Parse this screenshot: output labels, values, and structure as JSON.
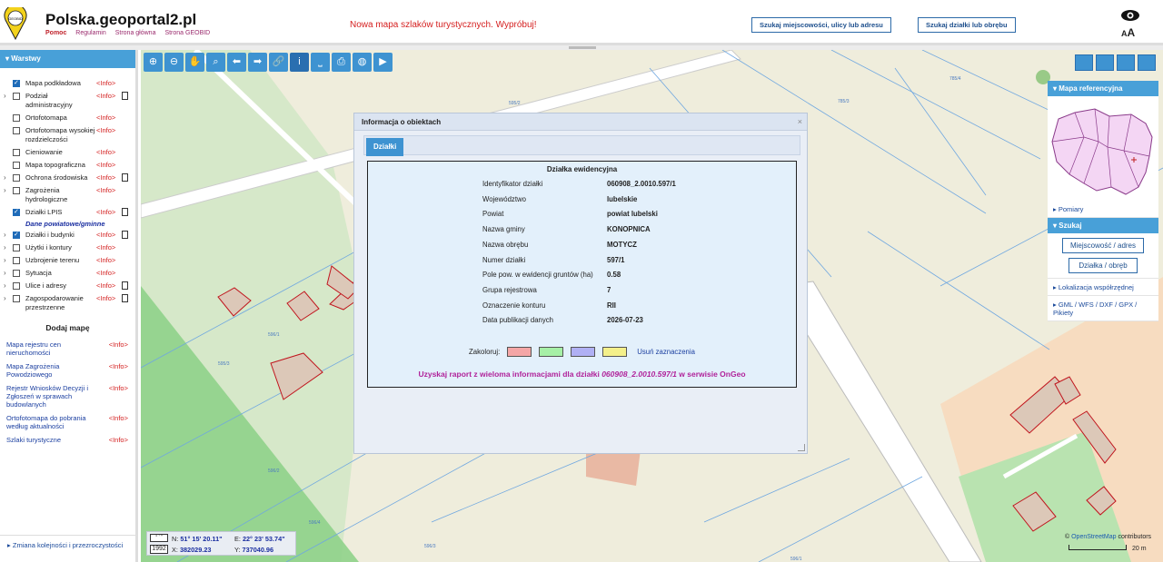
{
  "header": {
    "site_title": "Polska.geoportal2.pl",
    "logo_text": "GEOBID",
    "links": [
      "Pomoc",
      "Regulamin",
      "Strona główna",
      "Strona GEOBID"
    ],
    "promo": "Nowa mapa szlaków turystycznych. Wypróbuj!",
    "search_address_btn": "Szukaj miejscowości, ulicy lub adresu",
    "search_parcel_btn": "Szukaj działki lub obrębu",
    "font_size_label_small": "A",
    "font_size_label_large": "A"
  },
  "sidebar": {
    "title": "Warstwy",
    "layers": [
      {
        "name": "Mapa podkładowa",
        "checked": true,
        "chevron": false,
        "doc": false
      },
      {
        "name": "Podział administracyjny",
        "checked": false,
        "chevron": true,
        "doc": true
      },
      {
        "name": "Ortofotomapa",
        "checked": false,
        "chevron": false,
        "doc": false
      },
      {
        "name": "Ortofotomapa wysokiej rozdzielczości",
        "checked": false,
        "chevron": false,
        "doc": false
      },
      {
        "name": "Cieniowanie",
        "checked": false,
        "chevron": false,
        "doc": false
      },
      {
        "name": "Mapa topograficzna",
        "checked": false,
        "chevron": false,
        "doc": false
      },
      {
        "name": "Ochrona środowiska",
        "checked": false,
        "chevron": true,
        "doc": true
      },
      {
        "name": "Zagrożenia hydrologiczne",
        "checked": false,
        "chevron": true,
        "doc": false
      },
      {
        "name": "Działki LPIS",
        "checked": true,
        "chevron": false,
        "doc": true
      }
    ],
    "section_label": "Dane powiatowe/gminne",
    "layers2": [
      {
        "name": "Działki i budynki",
        "checked": true,
        "chevron": true,
        "doc": true
      },
      {
        "name": "Użytki i kontury",
        "checked": false,
        "chevron": true,
        "doc": false
      },
      {
        "name": "Uzbrojenie terenu",
        "checked": false,
        "chevron": true,
        "doc": false
      },
      {
        "name": "Sytuacja",
        "checked": false,
        "chevron": true,
        "doc": false
      },
      {
        "name": "Ulice i adresy",
        "checked": false,
        "chevron": true,
        "doc": true
      },
      {
        "name": "Zagospodarowanie przestrzenne",
        "checked": false,
        "chevron": true,
        "doc": true
      }
    ],
    "info_label": "<Info>",
    "add_map_title": "Dodaj mapę",
    "extra_maps": [
      "Mapa rejestru cen nieruchomości",
      "Mapa Zagrożenia Powodziowego",
      "Rejestr Wniosków Decyzji i Zgłoszeń w sprawach budowlanych",
      "Ortofotomapa do pobrania według aktualności",
      "Szlaki turystyczne"
    ],
    "bottom_link": "Zmiana kolejności i przezroczystości"
  },
  "toolbar": {
    "tools": [
      "zoom-in-icon",
      "zoom-out-icon",
      "pan-hand-icon",
      "zoom-box-icon",
      "back-arrow-icon",
      "forward-arrow-icon",
      "link-icon",
      "info-icon",
      "measure-icon",
      "print-icon",
      "globe-icon",
      "video-icon"
    ],
    "glyphs": [
      "⊕",
      "⊖",
      "✋",
      "⌕",
      "⬅",
      "➡",
      "🔗",
      "i",
      "⎵",
      "⎙",
      "◍",
      "▶"
    ]
  },
  "right_panel": {
    "ref_map_title": "Mapa referencyjna",
    "pomiary": "Pomiary",
    "szukaj": "Szukaj",
    "btn_locality": "Miejscowość / adres",
    "btn_parcel": "Działka / obręb",
    "coord_location": "Lokalizacja współrzędnej",
    "formats": "GML / WFS / DXF / GPX / Pikiety"
  },
  "dialog": {
    "title": "Informacja o obiektach",
    "close": "×",
    "tab": "Działki",
    "box_title": "Działka ewidencyjna",
    "rows": [
      {
        "k": "Identyfikator działki",
        "v": "060908_2.0010.597/1"
      },
      {
        "k": "Województwo",
        "v": "lubelskie"
      },
      {
        "k": "Powiat",
        "v": "powiat lubelski"
      },
      {
        "k": "Nazwa gminy",
        "v": "KONOPNICA"
      },
      {
        "k": "Nazwa obrębu",
        "v": "MOTYCZ"
      },
      {
        "k": "Numer działki",
        "v": "597/1"
      },
      {
        "k": "Pole pow. w ewidencji gruntów (ha)",
        "v": "0.58"
      },
      {
        "k": "Grupa rejestrowa",
        "v": "7"
      },
      {
        "k": "Oznaczenie konturu",
        "v": "RII"
      },
      {
        "k": "Data publikacji danych",
        "v": "2026-07-23"
      }
    ],
    "colorize_label": "Zakoloruj:",
    "swatch_colors": [
      "#f4a6a6",
      "#a6f0a6",
      "#b0b0f4",
      "#f4f08a"
    ],
    "clear_label": "Usuń zaznaczenia",
    "ongeo_prefix": "Uzyskaj raport z wieloma informacjami dla działki ",
    "ongeo_id": "060908_2.0010.597/1",
    "ongeo_suffix": " w serwisie OnGeo"
  },
  "coords": {
    "n_label": "N:",
    "n_value": "51° 15' 20.11\"",
    "e_label": "E:",
    "e_value": "22° 23' 53.74\"",
    "x_label": "X:",
    "x_value": "382029.23",
    "y_label": "Y:",
    "y_value": "737040.96",
    "crs": "1992",
    "dms": "° ' \""
  },
  "map": {
    "attribution_prefix": "© ",
    "attribution_link": "OpenStreetMap",
    "attribution_suffix": " contributors",
    "scale": "20 m",
    "parcel_labels": [
      "595/2",
      "785/3",
      "785/4",
      "596/1",
      "595/3",
      "596/2",
      "596/4",
      "596/3",
      "596/1"
    ]
  }
}
